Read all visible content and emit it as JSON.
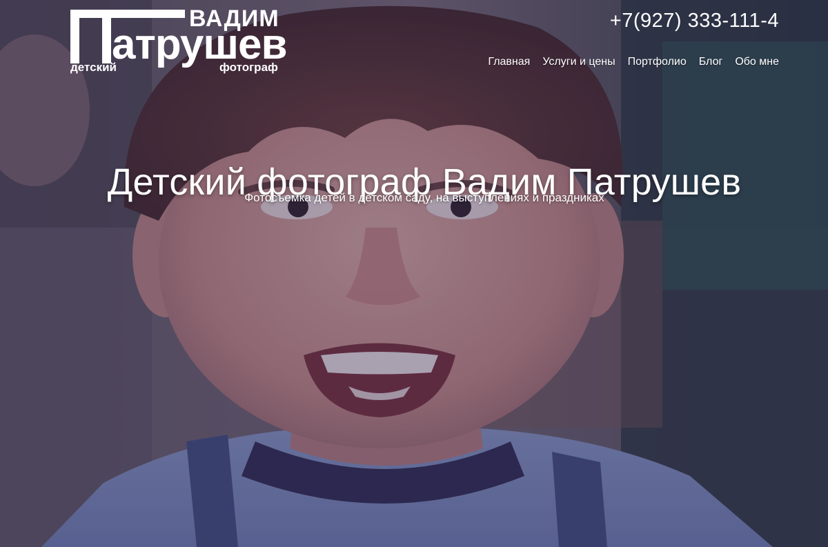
{
  "logo": {
    "first_name": "ВАДИМ",
    "last_name_rest": "атрушев",
    "sub_left": "детский",
    "sub_right": "фотограф"
  },
  "header": {
    "phone": "+7(927) 333-111-4"
  },
  "nav": {
    "items": [
      {
        "label": "Главная"
      },
      {
        "label": "Услуги и цены"
      },
      {
        "label": "Портфолио"
      },
      {
        "label": "Блог"
      },
      {
        "label": "Обо мне"
      }
    ]
  },
  "hero": {
    "title": "Детский фотограф Вадим Патрушев",
    "subtitle": "Фотосъемка детей в детском саду, на выступлениях и праздниках",
    "image": "smiling-boy-photo"
  },
  "colors": {
    "overlay": "#302448",
    "text": "#ffffff"
  }
}
